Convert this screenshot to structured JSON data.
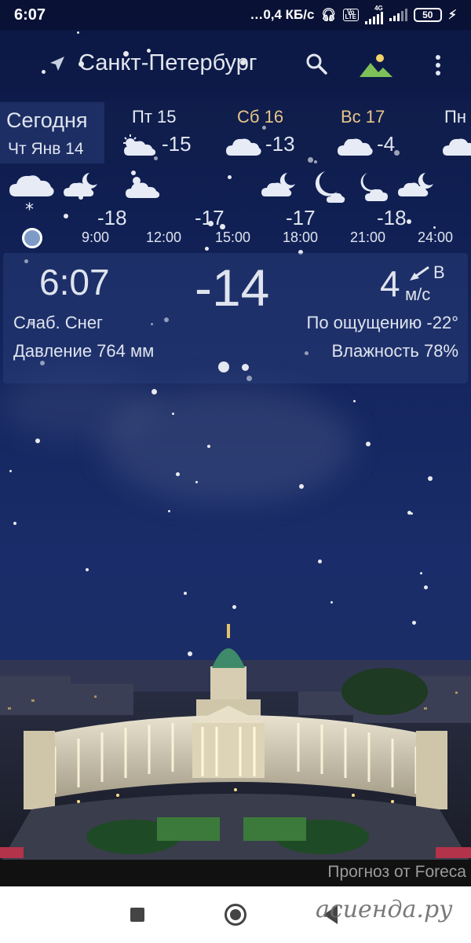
{
  "status_bar": {
    "time": "6:07",
    "network_speed": "…0,4 КБ/с",
    "volte": "Vo LTE",
    "net_type": "4G",
    "battery": "50"
  },
  "header": {
    "city": "Санкт-Петербург",
    "icons": [
      "navigation-arrow-icon",
      "search-icon",
      "landscape-icon",
      "more-vert-icon"
    ]
  },
  "days": {
    "today_label": "Сегодня",
    "today_date": "Чт Янв 14",
    "items": [
      {
        "name": "Пт 15",
        "temp": "-15",
        "color": "#e6ebf5",
        "icon": "cloud-sun-icon"
      },
      {
        "name": "Сб 16",
        "temp": "-13",
        "color": "#e8c58a",
        "icon": "cloud-icon"
      },
      {
        "name": "Вс 17",
        "temp": "-4",
        "color": "#e8c58a",
        "icon": "cloud-icon"
      },
      {
        "name": "Пн",
        "temp": "",
        "color": "#e6ebf5",
        "icon": "cloud-icon"
      }
    ]
  },
  "hourly": {
    "temps": [
      "-18",
      "-17",
      "-17",
      "-18"
    ],
    "times": [
      "9:00",
      "12:00",
      "15:00",
      "18:00",
      "21:00",
      "24:00"
    ]
  },
  "current": {
    "time": "6:07",
    "temp": "-14",
    "wind_speed": "4",
    "wind_dir": "В",
    "wind_unit": "м/с",
    "condition": "Слаб. Снег",
    "feels_like": "По ощущению -22°",
    "pressure": "Давление 764 мм",
    "humidity": "Влажность 78%"
  },
  "footer": {
    "credit": "Прогноз от Foreca",
    "watermark": "асиенда.ру"
  },
  "colors": {
    "sky_top": "#0b1742",
    "sky_mid": "#1a2d6a",
    "weekend": "#e8c58a"
  }
}
